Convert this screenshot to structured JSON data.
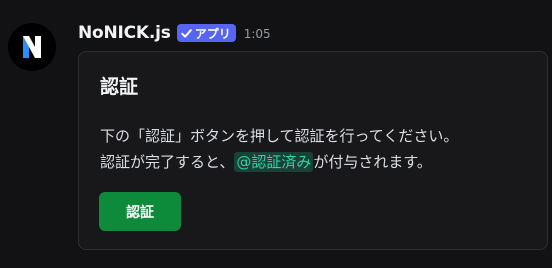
{
  "message": {
    "author": {
      "name": "NoNICK.js",
      "avatar_icon": "nonick-logo-icon",
      "avatar_letter": "N"
    },
    "app_tag": {
      "icon": "verified-check-icon",
      "label": "アプリ",
      "color": "#5865f2"
    },
    "timestamp": "1:05",
    "embed": {
      "title": "認証",
      "description_line1": "下の「認証」ボタンを押して認証を行ってください。",
      "description_line2_before": "認証が完了すると、",
      "role_mention": "@認証済み",
      "description_line2_after": "が付与されます。"
    },
    "button": {
      "label": "認証",
      "color": "#0e8a3b"
    }
  }
}
